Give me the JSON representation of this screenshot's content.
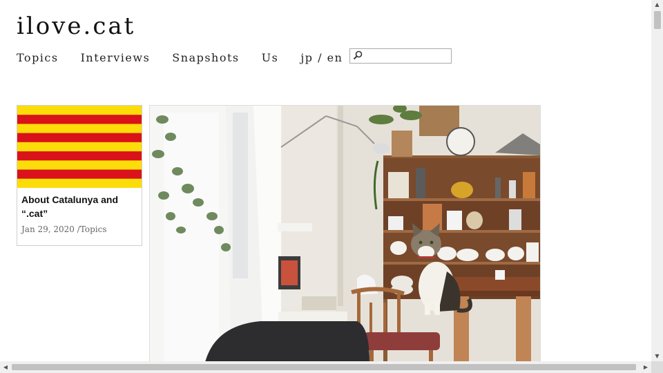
{
  "site": {
    "title": "ilove.cat"
  },
  "nav": {
    "items": [
      {
        "label": "Topics"
      },
      {
        "label": "Interviews"
      },
      {
        "label": "Snapshots"
      },
      {
        "label": "Us"
      },
      {
        "label": "jp / en"
      }
    ]
  },
  "search": {
    "value": "",
    "placeholder": "",
    "icon": "search-icon"
  },
  "posts": [
    {
      "title": "About Catalunya and “.cat”",
      "date": "Jan 29, 2020",
      "separator": "/",
      "category": "Topics",
      "image": "catalan-flag",
      "colors": {
        "yellow": "#fcdd09",
        "red": "#da121a"
      }
    }
  ],
  "featured_photo": {
    "subject": "cat-on-kitchen-table"
  },
  "colors": {
    "background": "#ffffff",
    "scrollbar_track": "#f0f0f0",
    "scrollbar_thumb": "#c1c1c1"
  }
}
